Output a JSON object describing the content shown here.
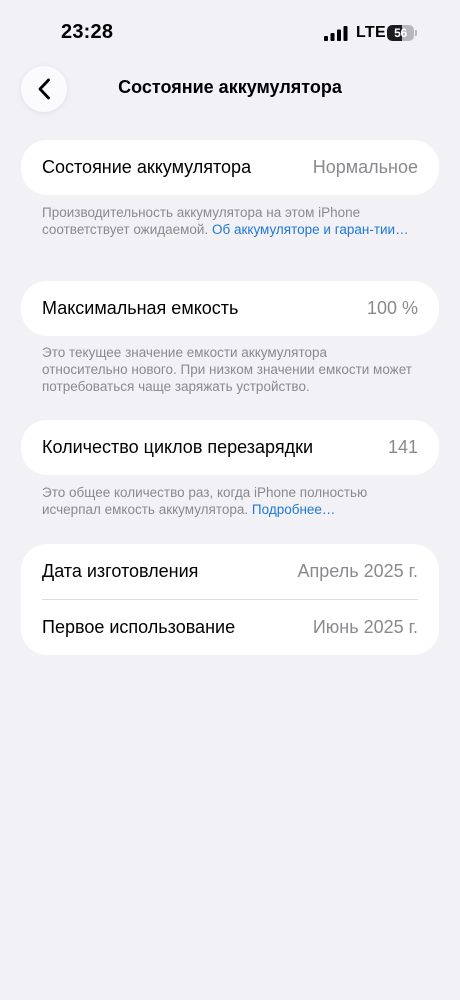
{
  "status_bar": {
    "time": "23:28",
    "network": "LTE",
    "battery_level": "56",
    "battery_fraction": 0.56,
    "signal_icon": "cellular-signal-icon",
    "battery_icon": "battery-icon"
  },
  "nav": {
    "back_icon": "chevron-left-icon",
    "title": "Состояние аккумулятора"
  },
  "health": {
    "label": "Состояние аккумулятора",
    "value": "Нормальное",
    "footnote_text": "Производительность аккумулятора на этом iPhone соответствует ожидаемой. ",
    "footnote_link": "Об аккумуляторе и гаран-тии…"
  },
  "capacity": {
    "label": "Максимальная емкость",
    "value": "100 %",
    "footnote_text": "Это текущее значение емкости аккумулятора относительно нового. При низком значении емкости может потребоваться чаще заряжать устройство."
  },
  "cycles": {
    "label": "Количество циклов перезарядки",
    "value": "141",
    "footnote_text": "Это общее количество раз, когда iPhone полностью исчерпал емкость аккумулятора. ",
    "footnote_link": "Подробнее…"
  },
  "dates": {
    "manufacture_label": "Дата изготовления",
    "manufacture_value": "Апрель 2025 г.",
    "first_use_label": "Первое использование",
    "first_use_value": "Июнь 2025 г."
  },
  "colors": {
    "background": "#f2f1f6",
    "card": "#ffffff",
    "secondary_text": "#8a8a8e",
    "link": "#1e78d8"
  }
}
